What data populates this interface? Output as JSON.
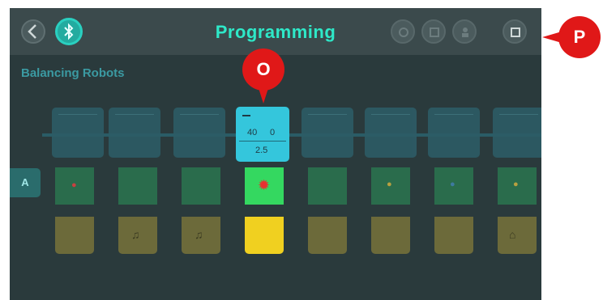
{
  "header": {
    "title": "Programming",
    "back_icon": "chevron-left-icon",
    "bluetooth_icon": "bluetooth-icon",
    "right_icons": [
      "camera-icon",
      "grid-icon",
      "person-icon",
      "stop-icon"
    ]
  },
  "section": {
    "title": "Balancing Robots"
  },
  "track": {
    "blocks": [
      {
        "value": ""
      },
      {
        "value": ""
      },
      {
        "value": ""
      },
      {
        "value_top": "40",
        "value_mid": "0",
        "value_bottom": "2.5",
        "active": true
      },
      {
        "value": ""
      },
      {
        "value": ""
      },
      {
        "value": ""
      },
      {
        "value": ""
      }
    ]
  },
  "row_a": {
    "label": "A"
  },
  "annotations": [
    {
      "label": "O"
    },
    {
      "label": "P"
    }
  ],
  "colors": {
    "accent": "#2ee8c8",
    "panel": "#2a3a3c",
    "active_block": "#34c6dc",
    "active_green": "#34d860",
    "active_yellow": "#f0d020",
    "pin": "#e01818"
  }
}
